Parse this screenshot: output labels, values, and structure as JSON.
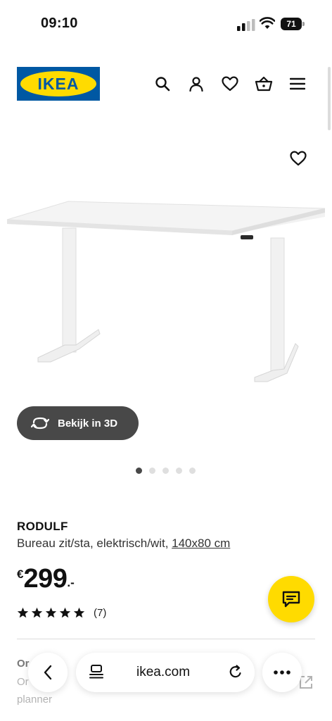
{
  "status_bar": {
    "time": "09:10",
    "battery": "71"
  },
  "header": {
    "logo_text": "IKEA",
    "icons": [
      "search-icon",
      "user-icon",
      "heart-icon",
      "basket-icon",
      "menu-icon"
    ]
  },
  "gallery": {
    "view_3d_label": "Bekijk in 3D",
    "dots_total": 5,
    "dot_active": 1
  },
  "product": {
    "name": "RODULF",
    "description": "Bureau zit/sta, elektrisch/wit, ",
    "size": "140x80 cm",
    "price_currency": "€",
    "price_integer": "299",
    "price_suffix": ".-",
    "rating_stars": 5,
    "review_count": "(7)"
  },
  "underneath": {
    "title": "Or",
    "line1": "Or",
    "line2": "planner"
  },
  "browser": {
    "url": "ikea.com"
  },
  "colors": {
    "ikea_blue": "#0058a3",
    "ikea_yellow": "#ffdb00",
    "button_dark": "#484848"
  }
}
